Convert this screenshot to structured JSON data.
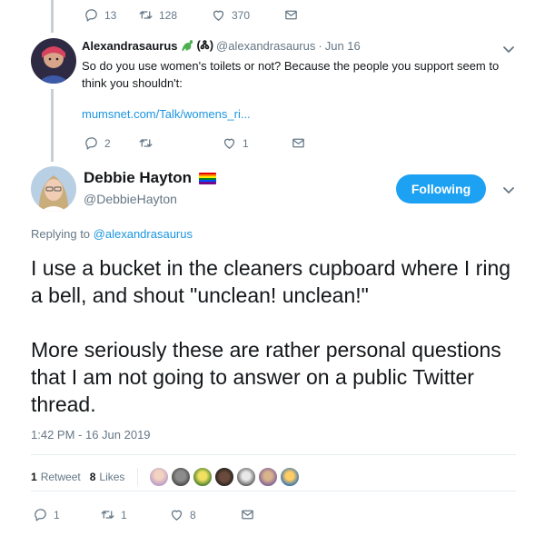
{
  "top_actions": {
    "replies": "13",
    "retweets": "128",
    "likes": "370"
  },
  "reply": {
    "name": "Alexandrasaurus",
    "badge": "(Ꮬ)",
    "handle": "@alexandrasaurus",
    "separator": "·",
    "date": "Jun 16",
    "text": "So do you use women's toilets or not? Because the people you support seem to think you shouldn't:",
    "link": "mumsnet.com/Talk/womens_ri...",
    "actions": {
      "replies": "2",
      "retweets": "",
      "likes": "1"
    }
  },
  "main_tweet": {
    "name": "Debbie Hayton",
    "handle": "@DebbieHayton",
    "follow_label": "Following",
    "replying_prefix": "Replying to",
    "replying_to": "@alexandrasaurus",
    "paragraph1": "I use a bucket in the cleaners cupboard where I ring a bell, and shout \"unclean! unclean!\"",
    "paragraph2": "More seriously these are rather personal questions that I am not going to answer on a public Twitter thread.",
    "timestamp": "1:42 PM - 16 Jun 2019",
    "retweet_count": "1",
    "retweet_label": "Retweet",
    "like_count": "8",
    "like_label": "Likes",
    "actions": {
      "replies": "1",
      "retweets": "1",
      "likes": "8"
    }
  },
  "colors": {
    "accent": "#1da1f2",
    "link": "#1b95e0",
    "muted": "#657786",
    "thread_line": "#c4cfd6",
    "pride": [
      "#e40303",
      "#ff8c00",
      "#ffed00",
      "#008026",
      "#004dff",
      "#750787"
    ]
  },
  "icons": [
    "reply-icon",
    "retweet-icon",
    "like-icon",
    "message-icon",
    "chevron-down-icon",
    "dinosaur-emoji",
    "pride-flag-emoji"
  ]
}
